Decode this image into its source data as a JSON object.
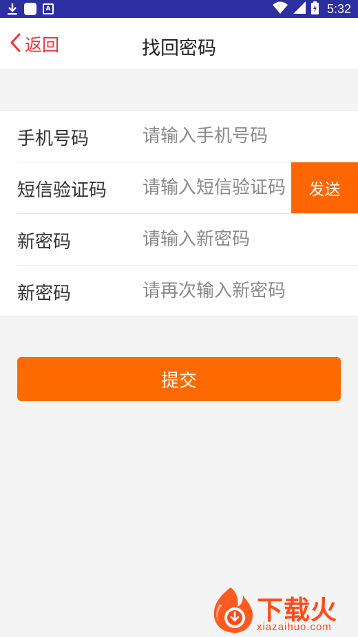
{
  "status_bar": {
    "time": "5:32",
    "icons": [
      "download-icon",
      "notification-square-icon",
      "app-a-icon",
      "wifi-icon",
      "signal-icon",
      "battery-icon"
    ]
  },
  "header": {
    "back_label": "返回",
    "title": "找回密码"
  },
  "form": {
    "rows": [
      {
        "label": "手机号码",
        "placeholder": "请输入手机号码",
        "value": ""
      },
      {
        "label": "短信验证码",
        "placeholder": "请输入短信验证码",
        "value": ""
      },
      {
        "label": "新密码",
        "placeholder": "请输入新密码",
        "value": ""
      },
      {
        "label": "新密码",
        "placeholder": "请再次输入新密码",
        "value": ""
      }
    ],
    "send_label": "发送",
    "submit_label": "提交"
  },
  "watermark": {
    "text": "下载火",
    "url": "xiazaihuo.com"
  },
  "colors": {
    "accent": "#ff6a00",
    "back": "#e8383d",
    "status_bar": "#2c2fa0"
  }
}
